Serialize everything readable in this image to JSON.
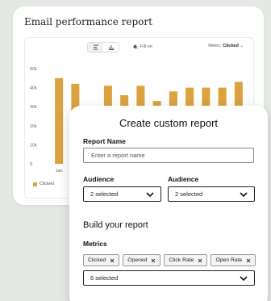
{
  "background_card": {
    "title": "Email performance report",
    "toolbar": {
      "fill_label": "Fill on",
      "metric_prefix": "Metric:",
      "metric_value": "Clicked"
    },
    "legend_label": "Clicked"
  },
  "chart_data": {
    "type": "bar",
    "categories": [
      "Jan",
      "",
      "",
      "",
      "",
      "",
      "",
      "",
      "",
      "",
      "",
      ""
    ],
    "series": [
      {
        "name": "Clicked",
        "values": [
          45,
          42,
          30,
          41,
          36,
          41,
          33,
          38,
          40,
          40,
          40,
          43
        ]
      }
    ],
    "y_ticks": [
      "0",
      "10k",
      "20k",
      "30k",
      "40k",
      "50k"
    ],
    "ylim": [
      0,
      50
    ],
    "grid": false,
    "legend": "bottom-left",
    "bar_color": "#dba23f"
  },
  "modal": {
    "title": "Create custom report",
    "report_name": {
      "label": "Report Name",
      "placeholder": "Enter a report name",
      "value": ""
    },
    "audience_1": {
      "label": "Audience",
      "value": "2 selected"
    },
    "audience_2": {
      "label": "Audience",
      "value": "2 selected"
    },
    "build_title": "Build your report",
    "metrics": {
      "label": "Metrics",
      "chips": [
        "Clicked",
        "Opened",
        "Click Rate",
        "Open Rate"
      ],
      "select_value": "6 selected"
    }
  }
}
